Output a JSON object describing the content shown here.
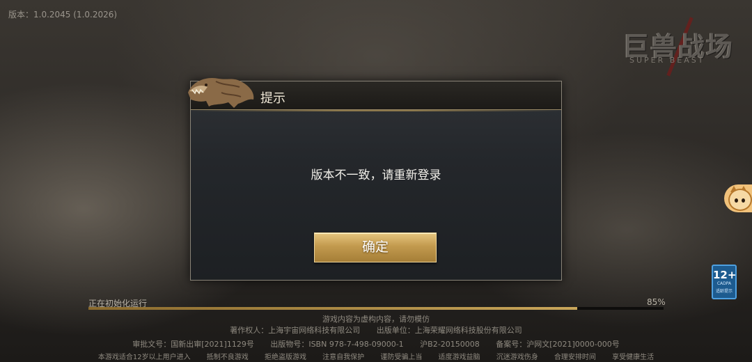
{
  "version_text": "版本：1.0.2045 (1.0.2026)",
  "logo": {
    "title": "巨兽战场",
    "subtitle": "SUPER BEAST"
  },
  "dialog": {
    "title": "提示",
    "message": "版本不一致，请重新登录",
    "confirm_label": "确定"
  },
  "progress": {
    "label": "正在初始化运行",
    "percent_text": "85%",
    "value": 0.85,
    "fill_color": "#c9a65a"
  },
  "age_rating": {
    "number": "12+",
    "org": "CADPA",
    "tip": "适龄提示"
  },
  "footer": {
    "line1": "游戏内容为虚构内容，请勿模仿",
    "line2": [
      "著作权人：上海宇宙网络科技有限公司",
      "出版单位：上海荣耀网络科技股份有限公司"
    ],
    "line3": [
      "审批文号：国新出审[2021]1129号",
      "出版物号：ISBN 978-7-498-09000-1",
      "沪B2-20150008",
      "备案号：沪网文[2021]0000-000号"
    ],
    "line4": [
      "本游戏适合12岁以上用户进入",
      "抵制不良游戏",
      "拒绝盗版游戏",
      "注意自我保护",
      "谨防受骗上当",
      "适度游戏益脑",
      "沉迷游戏伤身",
      "合理安排时间",
      "享受健康生活"
    ]
  },
  "colors": {
    "accent_gold": "#c9a65a",
    "dialog_bg": "#24272b",
    "button_gold": "#c29a4e"
  },
  "icons": {
    "mascot": "cat-mascot-icon",
    "dino": "dinosaur-icon"
  }
}
